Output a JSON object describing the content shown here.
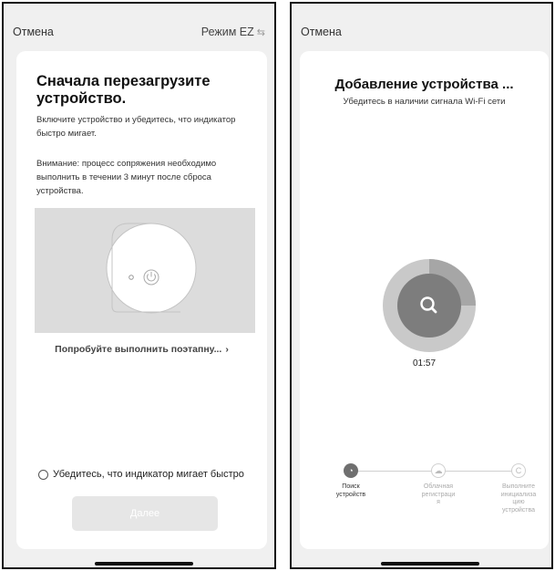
{
  "left": {
    "cancel": "Отмена",
    "mode": "Режим EZ",
    "title": "Сначала перезагрузите устройство.",
    "instruction": "Включите устройство и убедитесь, что индикатор быстро мигает.",
    "warning": "Внимание: процесс сопряжения необходимо выполнить в течении 3 минут после сброса устройства.",
    "try_link": "Попробуйте выполнить поэтапну...",
    "try_chevron": "›",
    "confirm": "Убедитесь, что индикатор мигает быстро",
    "next_button": "Далее"
  },
  "right": {
    "cancel": "Отмена",
    "title": "Добавление устройства ...",
    "subtitle": "Убедитесь в наличии сигнала Wi-Fi сети",
    "progress_fraction": 0.25,
    "timer": "01:57",
    "steps": [
      {
        "label": "Поиск\nустройств",
        "state": "active"
      },
      {
        "label": "Облачная\nрегистраци\nя",
        "state": "inactive"
      },
      {
        "label": "Выполните\nинициализа\nцию\nустройства",
        "state": "inactive"
      }
    ]
  },
  "icons": {
    "swap": "swap-arrows-icon",
    "search": "search-icon",
    "power": "power-icon",
    "cloud": "cloud-icon"
  },
  "colors": {
    "background": "#f0f0f0",
    "card": "#ffffff",
    "progress_track": "#c9c9c9",
    "progress_fill": "#a6a6a6",
    "progress_center": "#7d7d7d",
    "step_active": "#6f6f6f",
    "button_disabled": "#e6e6e6"
  }
}
